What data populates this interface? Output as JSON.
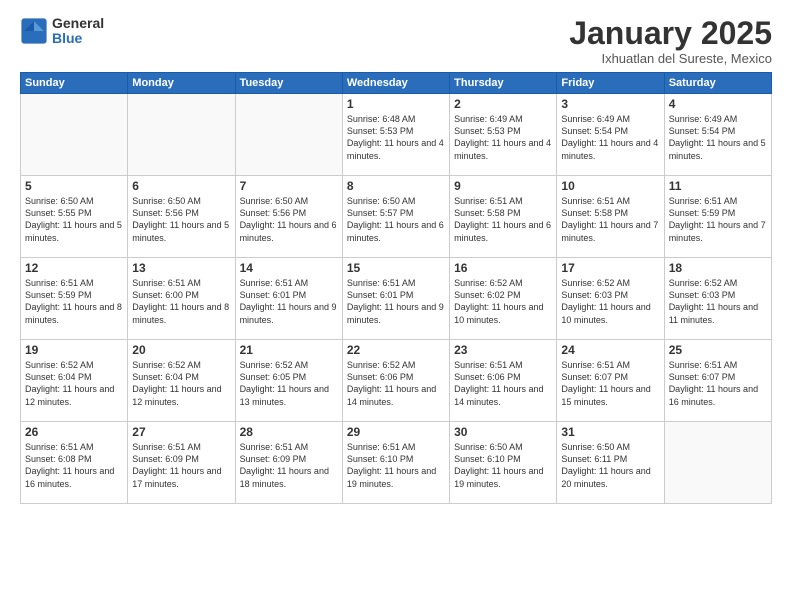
{
  "logo": {
    "general": "General",
    "blue": "Blue"
  },
  "header": {
    "title": "January 2025",
    "subtitle": "Ixhuatlan del Sureste, Mexico"
  },
  "weekdays": [
    "Sunday",
    "Monday",
    "Tuesday",
    "Wednesday",
    "Thursday",
    "Friday",
    "Saturday"
  ],
  "weeks": [
    [
      {
        "num": "",
        "empty": true
      },
      {
        "num": "",
        "empty": true
      },
      {
        "num": "",
        "empty": true
      },
      {
        "num": "1",
        "sunrise": "6:48 AM",
        "sunset": "5:53 PM",
        "daylight": "11 hours and 4 minutes."
      },
      {
        "num": "2",
        "sunrise": "6:49 AM",
        "sunset": "5:53 PM",
        "daylight": "11 hours and 4 minutes."
      },
      {
        "num": "3",
        "sunrise": "6:49 AM",
        "sunset": "5:54 PM",
        "daylight": "11 hours and 4 minutes."
      },
      {
        "num": "4",
        "sunrise": "6:49 AM",
        "sunset": "5:54 PM",
        "daylight": "11 hours and 5 minutes."
      }
    ],
    [
      {
        "num": "5",
        "sunrise": "6:50 AM",
        "sunset": "5:55 PM",
        "daylight": "11 hours and 5 minutes."
      },
      {
        "num": "6",
        "sunrise": "6:50 AM",
        "sunset": "5:56 PM",
        "daylight": "11 hours and 5 minutes."
      },
      {
        "num": "7",
        "sunrise": "6:50 AM",
        "sunset": "5:56 PM",
        "daylight": "11 hours and 6 minutes."
      },
      {
        "num": "8",
        "sunrise": "6:50 AM",
        "sunset": "5:57 PM",
        "daylight": "11 hours and 6 minutes."
      },
      {
        "num": "9",
        "sunrise": "6:51 AM",
        "sunset": "5:58 PM",
        "daylight": "11 hours and 6 minutes."
      },
      {
        "num": "10",
        "sunrise": "6:51 AM",
        "sunset": "5:58 PM",
        "daylight": "11 hours and 7 minutes."
      },
      {
        "num": "11",
        "sunrise": "6:51 AM",
        "sunset": "5:59 PM",
        "daylight": "11 hours and 7 minutes."
      }
    ],
    [
      {
        "num": "12",
        "sunrise": "6:51 AM",
        "sunset": "5:59 PM",
        "daylight": "11 hours and 8 minutes."
      },
      {
        "num": "13",
        "sunrise": "6:51 AM",
        "sunset": "6:00 PM",
        "daylight": "11 hours and 8 minutes."
      },
      {
        "num": "14",
        "sunrise": "6:51 AM",
        "sunset": "6:01 PM",
        "daylight": "11 hours and 9 minutes."
      },
      {
        "num": "15",
        "sunrise": "6:51 AM",
        "sunset": "6:01 PM",
        "daylight": "11 hours and 9 minutes."
      },
      {
        "num": "16",
        "sunrise": "6:52 AM",
        "sunset": "6:02 PM",
        "daylight": "11 hours and 10 minutes."
      },
      {
        "num": "17",
        "sunrise": "6:52 AM",
        "sunset": "6:03 PM",
        "daylight": "11 hours and 10 minutes."
      },
      {
        "num": "18",
        "sunrise": "6:52 AM",
        "sunset": "6:03 PM",
        "daylight": "11 hours and 11 minutes."
      }
    ],
    [
      {
        "num": "19",
        "sunrise": "6:52 AM",
        "sunset": "6:04 PM",
        "daylight": "11 hours and 12 minutes."
      },
      {
        "num": "20",
        "sunrise": "6:52 AM",
        "sunset": "6:04 PM",
        "daylight": "11 hours and 12 minutes."
      },
      {
        "num": "21",
        "sunrise": "6:52 AM",
        "sunset": "6:05 PM",
        "daylight": "11 hours and 13 minutes."
      },
      {
        "num": "22",
        "sunrise": "6:52 AM",
        "sunset": "6:06 PM",
        "daylight": "11 hours and 14 minutes."
      },
      {
        "num": "23",
        "sunrise": "6:51 AM",
        "sunset": "6:06 PM",
        "daylight": "11 hours and 14 minutes."
      },
      {
        "num": "24",
        "sunrise": "6:51 AM",
        "sunset": "6:07 PM",
        "daylight": "11 hours and 15 minutes."
      },
      {
        "num": "25",
        "sunrise": "6:51 AM",
        "sunset": "6:07 PM",
        "daylight": "11 hours and 16 minutes."
      }
    ],
    [
      {
        "num": "26",
        "sunrise": "6:51 AM",
        "sunset": "6:08 PM",
        "daylight": "11 hours and 16 minutes."
      },
      {
        "num": "27",
        "sunrise": "6:51 AM",
        "sunset": "6:09 PM",
        "daylight": "11 hours and 17 minutes."
      },
      {
        "num": "28",
        "sunrise": "6:51 AM",
        "sunset": "6:09 PM",
        "daylight": "11 hours and 18 minutes."
      },
      {
        "num": "29",
        "sunrise": "6:51 AM",
        "sunset": "6:10 PM",
        "daylight": "11 hours and 19 minutes."
      },
      {
        "num": "30",
        "sunrise": "6:50 AM",
        "sunset": "6:10 PM",
        "daylight": "11 hours and 19 minutes."
      },
      {
        "num": "31",
        "sunrise": "6:50 AM",
        "sunset": "6:11 PM",
        "daylight": "11 hours and 20 minutes."
      },
      {
        "num": "",
        "empty": true
      }
    ]
  ],
  "labels": {
    "sunrise": "Sunrise:",
    "sunset": "Sunset:",
    "daylight": "Daylight hours"
  }
}
